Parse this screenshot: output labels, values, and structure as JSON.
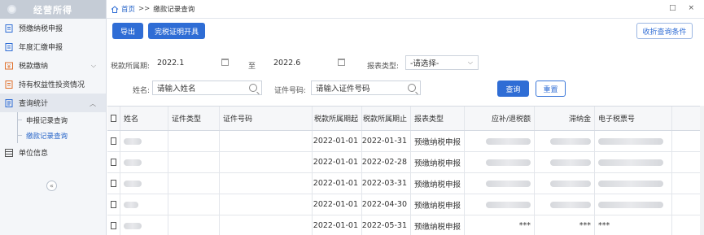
{
  "sidebar": {
    "title": "经营所得",
    "items": [
      {
        "label": "预缴纳税申报",
        "icon": "document-icon"
      },
      {
        "label": "年度汇缴申报",
        "icon": "document-icon"
      },
      {
        "label": "税款缴纳",
        "icon": "payment-icon"
      },
      {
        "label": "持有权益性投资情况",
        "icon": "document-icon"
      },
      {
        "label": "查询统计",
        "icon": "report-icon"
      },
      {
        "label": "单位信息",
        "icon": "grid-icon"
      }
    ],
    "subitems": [
      {
        "label": "申报记录查询"
      },
      {
        "label": "缴款记录查询"
      }
    ],
    "collapse_glyph": "«"
  },
  "breadcrumb": {
    "home": "首页",
    "sep": ">>",
    "current": "缴款记录查询"
  },
  "window_controls": "□ ×",
  "toolbar": {
    "export_label": "导出",
    "certificate_label": "完税证明开具",
    "collapse_label": "收折查询条件"
  },
  "filters": {
    "period_label": "税款所属期:",
    "period_start": "2022.1",
    "to_label": "至",
    "period_end": "2022.6",
    "report_type_label": "报表类型:",
    "report_type_value": "-请选择-",
    "name_label": "姓名:",
    "name_placeholder": "请输入姓名",
    "id_label": "证件号码:",
    "id_placeholder": "请输入证件号码",
    "query_label": "查询",
    "reset_label": "重置"
  },
  "table": {
    "columns": [
      "姓名",
      "证件类型",
      "证件号码",
      "税款所属期起",
      "税款所属期止",
      "报表类型",
      "应补/退税额",
      "滞纳金",
      "电子税票号"
    ],
    "rows": [
      {
        "start": "2022-01-01",
        "end": "2022-01-31",
        "type": "预缴纳税申报",
        "amount": "",
        "late_fee": "",
        "ticket": ""
      },
      {
        "start": "2022-01-01",
        "end": "2022-02-28",
        "type": "预缴纳税申报",
        "amount": "",
        "late_fee": "",
        "ticket": ""
      },
      {
        "start": "2022-01-01",
        "end": "2022-03-31",
        "type": "预缴纳税申报",
        "amount": "",
        "late_fee": "",
        "ticket": ""
      },
      {
        "start": "2022-01-01",
        "end": "2022-04-30",
        "type": "预缴纳税申报",
        "amount": "",
        "late_fee": "",
        "ticket": ""
      },
      {
        "start": "2022-01-01",
        "end": "2022-05-31",
        "type": "预缴纳税申报",
        "amount": "***",
        "late_fee": "***",
        "ticket": "***"
      }
    ]
  },
  "colors": {
    "accent": "#2f6dd5",
    "sidebar_header": "#c5ccd6",
    "sidebar_bg": "#f4f6f9"
  }
}
